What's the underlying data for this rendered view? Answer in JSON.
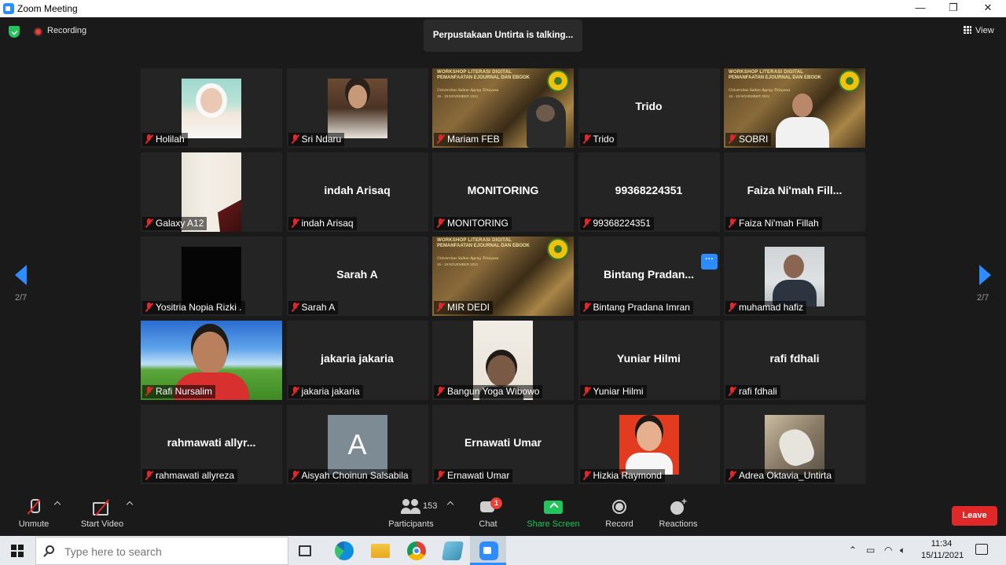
{
  "window": {
    "title": "Zoom Meeting",
    "minimize": "—",
    "restore": "❐",
    "close": "✕"
  },
  "meeting_top": {
    "recording_label": "Recording",
    "talking_text": "Perpustakaan Untirta is talking...",
    "view_label": "View"
  },
  "pager": {
    "left_label": "2/7",
    "right_label": "2/7"
  },
  "banner_text": {
    "line1": "WORKSHOP LITERASI DIGITAL",
    "line2": "PEMANFAATAN EJOURNAL DAN EBOOK",
    "line3": "Universitas Sultan Ageng Tirtayasa",
    "line4": "15 - 19 NOVEMBER 2021"
  },
  "participants": [
    {
      "label": "Holilah",
      "display": "",
      "media": "p-holilah"
    },
    {
      "label": "Sri Ndaru",
      "display": "",
      "media": "p-srindaru"
    },
    {
      "label": "Mariam FEB",
      "display": "",
      "media": "banner-dark"
    },
    {
      "label": "Trido",
      "display": "Trido",
      "media": ""
    },
    {
      "label": "SOBRI",
      "display": "",
      "media": "banner-white"
    },
    {
      "label": "Galaxy A12",
      "display": "",
      "media": "p-galaxy"
    },
    {
      "label": "indah Arisaq",
      "display": "indah Arisaq",
      "media": ""
    },
    {
      "label": "MONITORING",
      "display": "MONITORING",
      "media": ""
    },
    {
      "label": "99368224351",
      "display": "99368224351",
      "media": ""
    },
    {
      "label": "Faiza Ni'mah Fillah",
      "display": "Faiza Ni'mah Fill...",
      "media": ""
    },
    {
      "label": "Yositria Nopia Rizki .",
      "display": "",
      "media": "p-black"
    },
    {
      "label": "Sarah A",
      "display": "Sarah A",
      "media": ""
    },
    {
      "label": "MIR DEDI",
      "display": "",
      "media": "banner"
    },
    {
      "label": "Bintang Pradana Imran",
      "display": "Bintang  Pradan...",
      "media": ""
    },
    {
      "label": "muhamad hafiz",
      "display": "",
      "media": "p-hafiz"
    },
    {
      "label": "Rafi Nursalim",
      "display": "",
      "media": "p-rafi"
    },
    {
      "label": "jakaria jakaria",
      "display": "jakaria jakaria",
      "media": ""
    },
    {
      "label": "Bangun Yoga Wibowo",
      "display": "",
      "media": "p-bangun"
    },
    {
      "label": "Yuniar Hilmi",
      "display": "Yuniar Hilmi",
      "media": ""
    },
    {
      "label": "rafi fdhali",
      "display": "rafi fdhali",
      "media": ""
    },
    {
      "label": "rahmawati allyreza",
      "display": "rahmawati  allyr...",
      "media": ""
    },
    {
      "label": "Aisyah Choinun Salsabila",
      "display": "",
      "media": "p-aisyah",
      "initial": "A"
    },
    {
      "label": "Ernawati Umar",
      "display": "Ernawati Umar",
      "media": ""
    },
    {
      "label": "Hizkia Raymond",
      "display": "",
      "media": "p-hizkia"
    },
    {
      "label": "Adrea Oktavia_Untirta",
      "display": "",
      "media": "p-adrea"
    }
  ],
  "tile_more_label": "···",
  "toolbar": {
    "unmute": "Unmute",
    "start_video": "Start Video",
    "participants_label": "Participants",
    "participants_count": "153",
    "chat_label": "Chat",
    "chat_badge": "1",
    "share_label": "Share Screen",
    "record_label": "Record",
    "reactions_label": "Reactions",
    "leave_label": "Leave"
  },
  "colors": {
    "accent": "#2d8cff",
    "share": "#23c35d",
    "leave": "#e02828"
  },
  "taskbar": {
    "search_placeholder": "Type here to search",
    "time": "11:34",
    "date": "15/11/2021"
  }
}
